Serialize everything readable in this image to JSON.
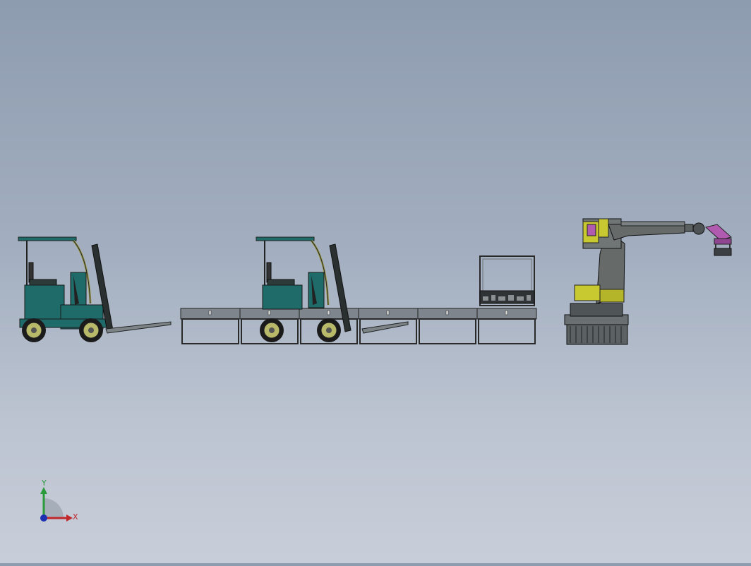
{
  "scene": {
    "background_top": "#8e9cb0",
    "background_bottom": "#c8ced9",
    "objects": [
      {
        "name": "forklift-left"
      },
      {
        "name": "roller-conveyor-line"
      },
      {
        "name": "forklift-center"
      },
      {
        "name": "pallet-cage"
      },
      {
        "name": "industrial-robot-arm"
      }
    ]
  },
  "triad": {
    "x_label": "X",
    "y_label": "Y",
    "x_color": "#c0282d",
    "y_color": "#2a9a3a",
    "z_color": "#1c2fb0"
  },
  "colors": {
    "forklift_body": "#1f6b6a",
    "forklift_frame": "#b9b96a",
    "robot_body": "#666b6a",
    "robot_accent": "#c8c830",
    "gripper": "#b05ab0",
    "conveyor": "#8a8f96"
  }
}
